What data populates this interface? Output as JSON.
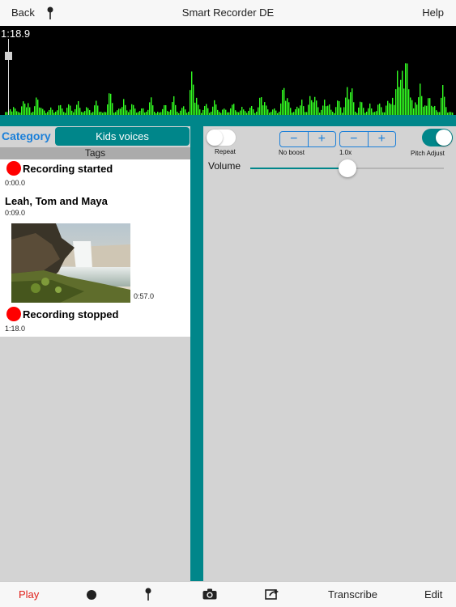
{
  "nav": {
    "back_label": "Back",
    "title": "Smart Recorder DE",
    "help_label": "Help"
  },
  "waveform": {
    "time": "1:18.9",
    "wave_color": "#33ff22",
    "playhead_progress": 0.0
  },
  "category": {
    "label": "Category",
    "selected": "Kids voices"
  },
  "tags": {
    "header": "Tags",
    "items": [
      {
        "title": "Recording started",
        "time": "0:00.0",
        "marker": "red-dot"
      },
      {
        "title": "Leah, Tom and Maya",
        "time": "0:09.0",
        "marker": "none"
      },
      {
        "title": "",
        "time": "0:57.0",
        "marker": "photo"
      },
      {
        "title": "Recording stopped",
        "time": "1:18.0",
        "marker": "red-dot"
      }
    ]
  },
  "controls": {
    "repeat_label": "Repeat",
    "repeat_on": false,
    "boost_label": "No boost",
    "speed_label": "1.0x",
    "pitch_label": "Pitch Adjust",
    "pitch_on": true,
    "minus": "−",
    "plus": "+",
    "volume_label": "Volume",
    "volume_level": 0.5
  },
  "bottom": {
    "play_label": "Play",
    "transcribe_label": "Transcribe",
    "edit_label": "Edit"
  },
  "colors": {
    "accent": "#00868a",
    "link_blue": "#1a7fd9",
    "record_red": "#ff0000",
    "play_red": "#e0201a"
  }
}
